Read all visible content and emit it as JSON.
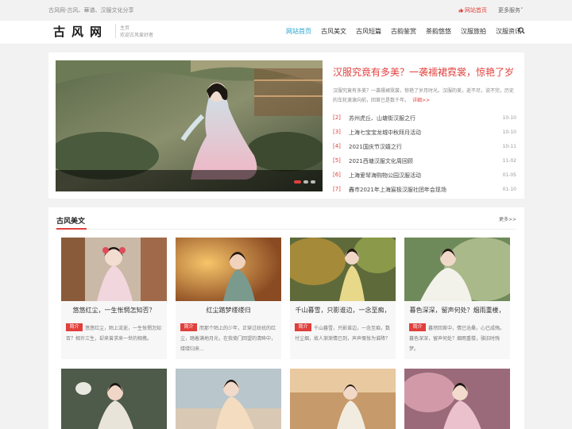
{
  "topbar": {
    "tagline": "古风网-古风、華谱、汉服文化分享",
    "home_link": "网站首页",
    "more_services": "更多服务"
  },
  "header": {
    "logo": "古风网",
    "sub1": "主页",
    "sub2": "欢迎古风爱好者",
    "nav": [
      "网站首页",
      "古风美文",
      "古风短篇",
      "古韵鉴赏",
      "茶韵悠悠",
      "汉服旅拍",
      "汉服资讯"
    ]
  },
  "hero": {
    "title": "汉服究竟有多美？一袭襦裙霓裳，惊艳了岁",
    "desc": "汉服究竟有多美？一袭襦裙霓裳，惊艳了岁月时光。汉服的美，逝不尽，说不完，历史的车轮滚滚向前，回首已是数千年。",
    "more": "详细>>",
    "news": [
      {
        "idx": "[2]",
        "title": "苏州虎丘、山塘街汉服之行",
        "date": "10-10"
      },
      {
        "idx": "[3]",
        "title": "上海七宝宝龙城中秋拜月活动",
        "date": "10-10"
      },
      {
        "idx": "[4]",
        "title": "2021国庆节汉嬉之行",
        "date": "10-11"
      },
      {
        "idx": "[5]",
        "title": "2021西塘汉服文化周回顾",
        "date": "11-02"
      },
      {
        "idx": "[6]",
        "title": "上海爱琴海购物公园汉服活动",
        "date": "01-05"
      },
      {
        "idx": "[7]",
        "title": "轟市2021年上海宸极汉服社团年会现场",
        "date": "01-10"
      }
    ]
  },
  "section": {
    "title": "古风美文",
    "more": "更多>>",
    "tag_label": "简介",
    "cards": [
      {
        "title": "悠悠红尘，一生怅惘怎知否？",
        "desc": "悠悠红尘，陌上流逝，一生怅惘怎知否？相许三生，却来曾求来一世的相携。"
      },
      {
        "title": "红尘踏梦缕缕归",
        "desc": "而那个陌上的少年，正穿过纷扰的红尘，踏着满地月光，在我倚门回望的清眸中，缕缕归来..."
      },
      {
        "title": "千山暮雪，只影谁边，一念至痴，",
        "desc": "千山暮雪，只影谁边，一念至痴，数付尘烟，故人渐渐情已到，声声慨怅为谁降？"
      },
      {
        "title": "暮色深深，留声何处？烟雨重楼，",
        "desc": "暮然回首中，情已沧桑，心已成殇。暮色深深，留声何处？烟雨重楼，骆旧时残梦。"
      }
    ]
  },
  "colors": {
    "accent": "#e0403c",
    "nav_active": "#2aa3cf"
  }
}
